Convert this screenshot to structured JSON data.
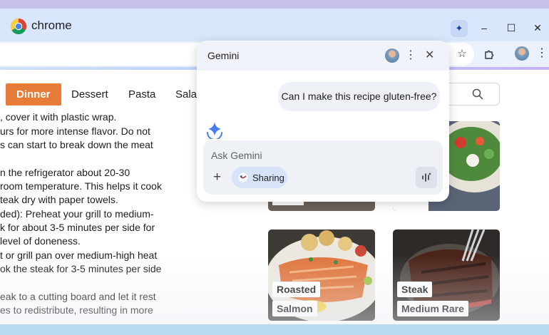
{
  "window": {
    "app_name": "chrome",
    "gemini_button_icon": "gemini-sparkle-icon",
    "controls": {
      "minimize": "–",
      "maximize": "☐",
      "close": "✕"
    }
  },
  "toolbar": {
    "icons": [
      "star-icon",
      "extensions-icon",
      "profile-avatar",
      "more-icon"
    ]
  },
  "page": {
    "tabs": [
      {
        "label": "Dinner",
        "active": true
      },
      {
        "label": "Dessert",
        "active": false
      },
      {
        "label": "Pasta",
        "active": false
      },
      {
        "label": "Salad",
        "active": false
      }
    ],
    "recipe_lines": [
      ", cover it with plastic wrap.",
      "urs for more intense flavor. Do not",
      "s can start to break down the meat",
      "",
      "n the refrigerator about 20-30",
      "room temperature. This helps it cook",
      "teak dry with paper towels.",
      "ded): Preheat your grill to medium-",
      "k for about 3-5 minutes per side for",
      "level of doneness.",
      "t or grill pan over medium-high heat",
      "ok the steak for 3-5 minutes per side",
      "",
      "eak to a cutting board and let it rest",
      "es to redistribute, resulting in more"
    ],
    "cards": [
      {
        "id": "salad-bowl",
        "labels": []
      },
      {
        "id": "top-left",
        "labels": []
      },
      {
        "id": "salmon",
        "labels": [
          "Roasted",
          "Salmon"
        ]
      },
      {
        "id": "steak",
        "labels": [
          "Steak",
          "Medium Rare"
        ]
      }
    ]
  },
  "gemini": {
    "title": "Gemini",
    "user_message": "Can I make this recipe gluten-free?",
    "input_placeholder": "Ask Gemini",
    "add_label": "+",
    "sharing_label": "Sharing",
    "more_symbol": "⋮",
    "close_symbol": "✕"
  },
  "colors": {
    "accent_tab": "#e77b38",
    "titlebar": "#d8e7fb",
    "gemini_blue": "#4a7bf0"
  }
}
